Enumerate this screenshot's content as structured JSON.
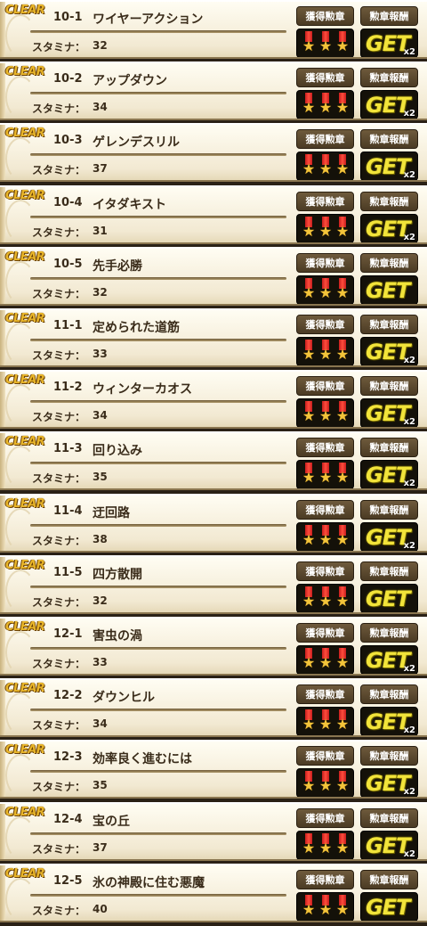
{
  "labels": {
    "clear": "CLEAR",
    "stamina_label": "スタミナ：",
    "medal_button": "獲得勲章",
    "reward_button": "勲章報酬",
    "get": "GET"
  },
  "stages": [
    {
      "id": "10-1",
      "name": "ワイヤーアクション",
      "stamina": "32",
      "multiplier": "x2"
    },
    {
      "id": "10-2",
      "name": "アップダウン",
      "stamina": "34",
      "multiplier": "x2"
    },
    {
      "id": "10-3",
      "name": "ゲレンデスリル",
      "stamina": "37",
      "multiplier": "x2"
    },
    {
      "id": "10-4",
      "name": "イタダキスト",
      "stamina": "31",
      "multiplier": "x2"
    },
    {
      "id": "10-5",
      "name": "先手必勝",
      "stamina": "32",
      "multiplier": ""
    },
    {
      "id": "11-1",
      "name": "定められた道筋",
      "stamina": "33",
      "multiplier": "x2"
    },
    {
      "id": "11-2",
      "name": "ウィンターカオス",
      "stamina": "34",
      "multiplier": "x2"
    },
    {
      "id": "11-3",
      "name": "回り込み",
      "stamina": "35",
      "multiplier": "x2"
    },
    {
      "id": "11-4",
      "name": "迂回路",
      "stamina": "38",
      "multiplier": "x2"
    },
    {
      "id": "11-5",
      "name": "四方散開",
      "stamina": "32",
      "multiplier": ""
    },
    {
      "id": "12-1",
      "name": "害虫の渦",
      "stamina": "33",
      "multiplier": "x2"
    },
    {
      "id": "12-2",
      "name": "ダウンヒル",
      "stamina": "34",
      "multiplier": "x2"
    },
    {
      "id": "12-3",
      "name": "効率良く進むには",
      "stamina": "35",
      "multiplier": "x2"
    },
    {
      "id": "12-4",
      "name": "宝の丘",
      "stamina": "37",
      "multiplier": "x2"
    },
    {
      "id": "12-5",
      "name": "氷の神殿に住む悪魔",
      "stamina": "40",
      "multiplier": ""
    }
  ]
}
